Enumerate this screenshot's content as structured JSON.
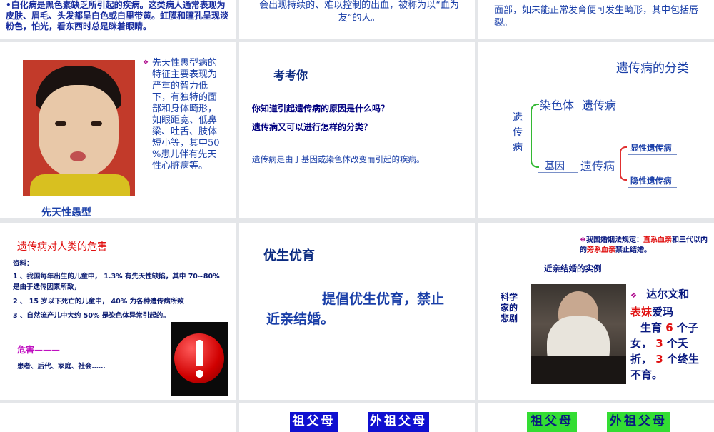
{
  "slides": {
    "r0c1": {
      "text": "•白化病是黑色素缺乏所引起的疾病。这类病人通常表现为皮肤、眉毛、头发都呈白色或白里带黄。虹膜和瞳孔呈现淡粉色，怕光，看东西时总是眯着眼睛。"
    },
    "r0c2": {
      "text": "会出现持续的、难以控制的出血，被称为以“血为友”的人。"
    },
    "r0c3": {
      "text": "面部，如未能正常发育便可发生畸形，其中包括唇裂。"
    },
    "r1c1": {
      "bullet": "先天性愚型病的特征主要表现为严重的智力低下，有独特的面部和身体畸形，如眼距宽、低鼻梁、吐舌、肢体短小等，其中50 %患儿伴有先天性心脏病等。",
      "caption": "先天性愚型"
    },
    "r1c2": {
      "title": "考考你",
      "q1": "你知道引起遗传病的原因是什么吗？",
      "q2": "遗传病又可以进行怎样的分类？",
      "answer": "遗传病是由于基因或染色体改变而引起的疾病。"
    },
    "r1c3": {
      "title": "遗传病的分类",
      "root": "遗传病",
      "branch1_a": "染色体",
      "branch1_b": "遗传病",
      "branch2_a": "基因",
      "branch2_b": "遗传病",
      "leaf1": "显性遗传病",
      "leaf2": "隐性遗传病"
    },
    "r2c1": {
      "title": "遗传病对人类的危害",
      "source": "资料：",
      "item1": "1 、我国每年出生的儿童中， 1.3% 有先天性缺陷，其中 70~80% 是由于遗传因素所致，",
      "item2": "2 、 15 岁以下死亡的儿童中， 40% 为各种遗传病所致",
      "item3": "3 、自然流产儿中大约 50% 是染色体异常引起的。",
      "harm": "危害———",
      "victims": "患者、后代、家庭、社会……"
    },
    "r2c2": {
      "title": "优生优育",
      "body": "提倡优生优育，禁止近亲结婚。"
    },
    "r2c3": {
      "law_pre": "我国婚姻法规定：",
      "law_red1": "直系血亲",
      "law_mid": "和三代以内的",
      "law_red2": "旁系血亲",
      "law_post": "禁止结婚。",
      "subtitle": "近亲结婚的实例",
      "side": "科学家的悲剧",
      "darwin_name": "达尔文和",
      "darwin_cousin": "表妹",
      "darwin_rest": "爱玛",
      "kids_pre": "生育",
      "kids_num": "6",
      "kids_post": "个子女，",
      "died_num": "3",
      "died_post": "个夭折，",
      "sterile_num": "3",
      "sterile_post": "个终生不育。"
    },
    "r3c2": {
      "left": "祖父母",
      "right": "外祖父母"
    },
    "r3c3": {
      "left": "祖父母",
      "right": "外祖父母"
    }
  },
  "colors": {
    "navy": "#000080",
    "blue": "#1a3fa8",
    "red": "#e01010",
    "green_label": "#33dd33",
    "blue_label": "#1010d0"
  }
}
